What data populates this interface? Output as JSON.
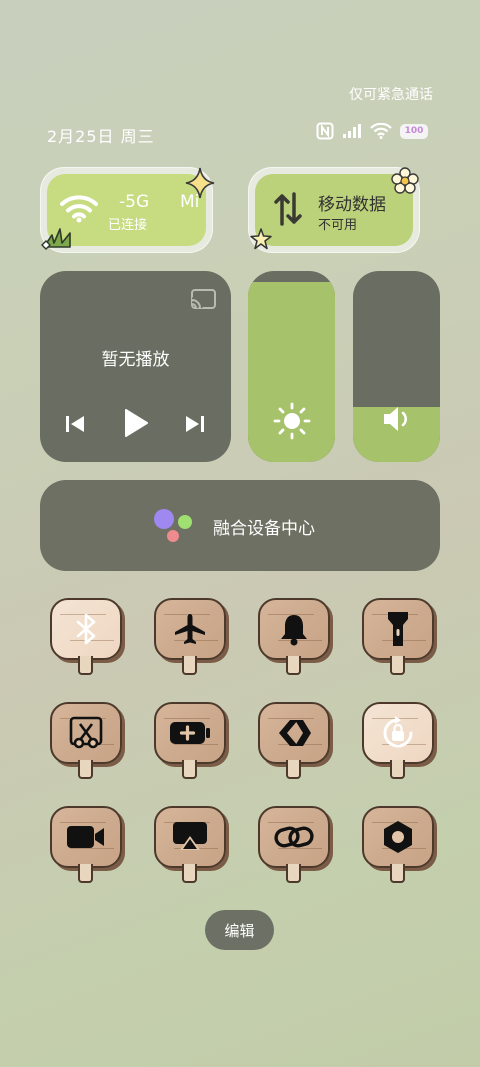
{
  "status_bar": {
    "emergency_text": "仅可紧急通话",
    "datetime": "2月25日 周三",
    "battery_label": "100"
  },
  "wifi_tile": {
    "network": "-5G",
    "network_suffix": "Mi",
    "status": "已连接",
    "icon": "wifi-icon"
  },
  "mobile_tile": {
    "title": "移动数据",
    "status": "不可用",
    "icon": "mobile-data-icon"
  },
  "media": {
    "label": "暂无播放",
    "controls": [
      "previous-icon",
      "play-icon",
      "next-icon"
    ],
    "cast_icon": "cast-icon"
  },
  "sliders": {
    "brightness_level": 0.94,
    "volume_level": 0.29
  },
  "device_center": {
    "label": "融合设备中心"
  },
  "toggles": [
    {
      "name": "bluetooth",
      "icon": "bluetooth-icon",
      "active": false
    },
    {
      "name": "airplane",
      "icon": "airplane-icon",
      "active": true
    },
    {
      "name": "bell",
      "icon": "bell-icon",
      "active": true
    },
    {
      "name": "flashlight",
      "icon": "flashlight-icon",
      "active": true
    },
    {
      "name": "screenshot",
      "icon": "scissors-icon",
      "active": true
    },
    {
      "name": "battery-saver",
      "icon": "battery-plus-icon",
      "active": true
    },
    {
      "name": "connect",
      "icon": "link-arrow-icon",
      "active": true
    },
    {
      "name": "rotation-lock",
      "icon": "rotation-lock-icon",
      "active": false
    },
    {
      "name": "screen-record",
      "icon": "video-camera-icon",
      "active": true
    },
    {
      "name": "cast-screen",
      "icon": "airplay-icon",
      "active": true
    },
    {
      "name": "link",
      "icon": "link-icon",
      "active": true
    },
    {
      "name": "settings",
      "icon": "hexagon-nut-icon",
      "active": true
    }
  ],
  "edit_button": {
    "label": "编辑"
  },
  "colors": {
    "tile_green": "#c7dc80",
    "slider_fill": "#a6c26a",
    "dark_panel": "#6a6d61"
  }
}
